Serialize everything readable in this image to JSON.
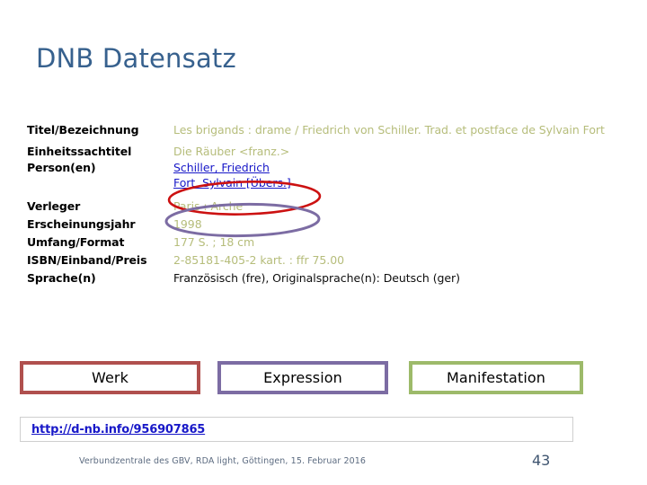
{
  "slide": {
    "title": "DNB Datensatz"
  },
  "record": {
    "rows": [
      {
        "label": "Titel/Bezeichnung",
        "value": "Les brigands : drame / Friedrich von Schiller. Trad. et postface de Sylvain Fort"
      },
      {
        "label": "Einheitssachtitel",
        "value": "Die Räuber <franz.>"
      },
      {
        "label": "Person(en)",
        "links": [
          "Schiller, Friedrich",
          "Fort, Sylvain [Übers.]"
        ]
      },
      {
        "label": "Verleger",
        "value": "Paris : Arche"
      },
      {
        "label": "Erscheinungsjahr",
        "value": "1998"
      },
      {
        "label": "Umfang/Format",
        "value": "177 S. ; 18 cm"
      },
      {
        "label": "ISBN/Einband/Preis",
        "value": "2-85181-405-2 kart. : ffr 75.00"
      },
      {
        "label": "Sprache(n)",
        "value": "Französisch (fre), Originalsprache(n): Deutsch (ger)"
      }
    ]
  },
  "annotations": {
    "ellipse_work": {
      "color": "#cc1111",
      "target": "Schiller, Friedrich"
    },
    "ellipse_expression": {
      "color": "#7c6ca3",
      "target": "Fort, Sylvain [Übers.]"
    }
  },
  "frbr_boxes": [
    {
      "label": "Werk",
      "color": "#b0504e"
    },
    {
      "label": "Expression",
      "color": "#7c6ca3"
    },
    {
      "label": "Manifestation",
      "color": "#9dba6a"
    }
  ],
  "url_bar": {
    "url": "http://d-nb.info/956907865"
  },
  "footer": {
    "text": "Verbundzentrale des GBV, RDA light, Göttingen, 15. Februar 2016",
    "page_number": "43"
  }
}
